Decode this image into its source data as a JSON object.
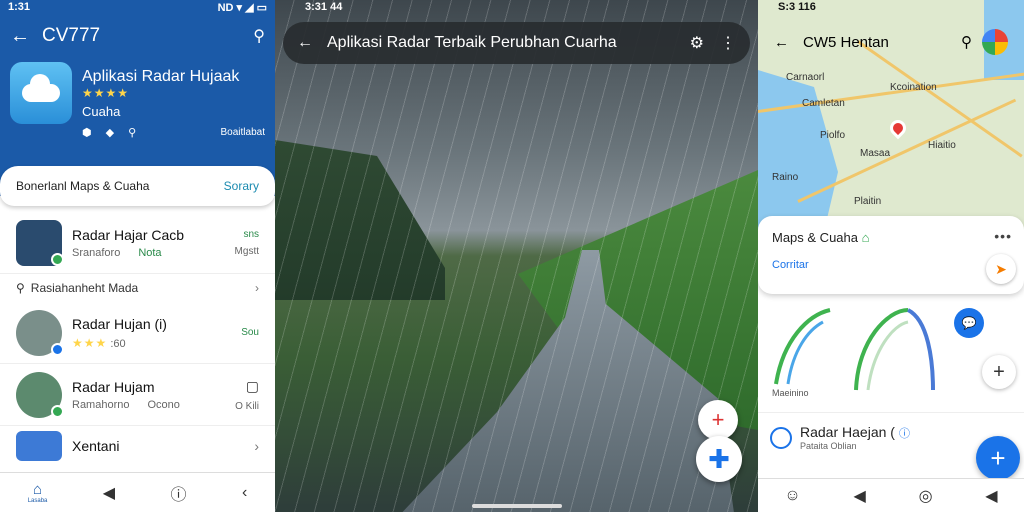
{
  "left": {
    "status": {
      "time": "1:31",
      "icons": "ND ▾ ◢ ▭"
    },
    "appbar": {
      "title": "CV777"
    },
    "app": {
      "name": "Aplikasi Radar Hujaak",
      "stars": "★★★★",
      "developer": "Cuaha",
      "meta_right": "Boaitlabat"
    },
    "search": {
      "placeholder": "Bonerlanl Maps & Cuaha",
      "action": "Sorary"
    },
    "items": [
      {
        "title": "Radar Hajar Cacb",
        "sub1": "Sranaforo",
        "sub2": "Nota",
        "right_top": "sns",
        "right_bottom": "Mgstt"
      },
      {
        "title": "Radar Hujan (i)",
        "stars": "★★★",
        "sub1": ":60",
        "right_top": "Sou"
      },
      {
        "title": "Radar Hujam",
        "sub1": "Ramahorno",
        "sub2": "Ocono",
        "right_top": "",
        "right_bottom": "O Kili"
      },
      {
        "title": "Xentani",
        "sub1": "",
        "right_top": "›"
      }
    ],
    "subrow": {
      "label": "Rasiahanheht Mada"
    },
    "nav": {
      "home_label": "Lasaba"
    }
  },
  "mid": {
    "status": {
      "time": "3:31 44"
    },
    "title": "Aplikasi Radar Terbaik Perubhan Cuarha"
  },
  "right": {
    "status": {
      "time": "S:3 116"
    },
    "title": "CW5 Hentan",
    "map_labels": [
      "Carnaorl",
      "Kcoination",
      "Camletan",
      "Piolfo",
      "Masaa",
      "Hiaitio",
      "Raino",
      "Plaitin"
    ],
    "sheet": {
      "title": "Maps & Cuaha",
      "link": "Corritar"
    },
    "arc_label": "Maeinino",
    "row": {
      "title": "Radar Haejan (",
      "sub": "Pataita Oblian"
    }
  }
}
